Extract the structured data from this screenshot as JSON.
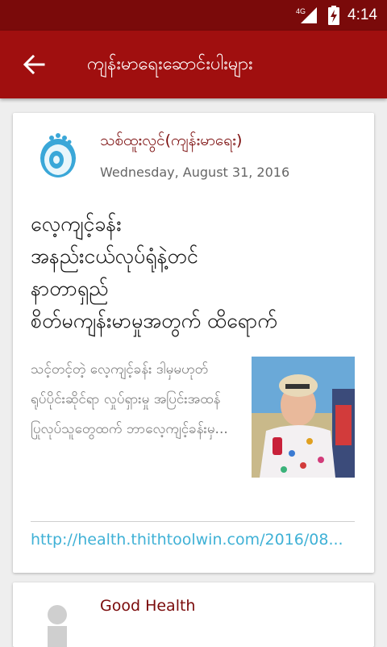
{
  "status_bar": {
    "network_label": "4G",
    "time": "4:14"
  },
  "app_bar": {
    "title": "ကျန်းမာရေးဆောင်းပါးများ"
  },
  "articles": [
    {
      "source": "သစ်ထူးလွင်(ကျန်းမာရေး)",
      "date": "Wednesday, August 31, 2016",
      "headline": "လေ့ကျင့်ခန်း\nအနည်းငယ်လုပ်ရုံနဲ့တင်\nနာတာရှည်\nစိတ်မကျန်းမာမှုအတွက် ထိရောက်",
      "summary": "သင့်တင့်တဲ့ လေ့ကျင့်ခန်း ဒါမှမဟုတ် ရုပ်ပိုင်းဆိုင်ရာ လှုပ်ရှားမှု အပြင်းအထန် ပြုလုပ်သူတွေထက် ဘာလေ့ကျင့်ခန်းမှ...",
      "link": "http://health.thithtoolwin.com/2016/08..."
    },
    {
      "source": "Good Health"
    }
  ],
  "colors": {
    "status_bar": "#7a0a0a",
    "app_bar": "#a00f0f",
    "source_text": "#7a0a0a",
    "link": "#3fb1d6"
  }
}
